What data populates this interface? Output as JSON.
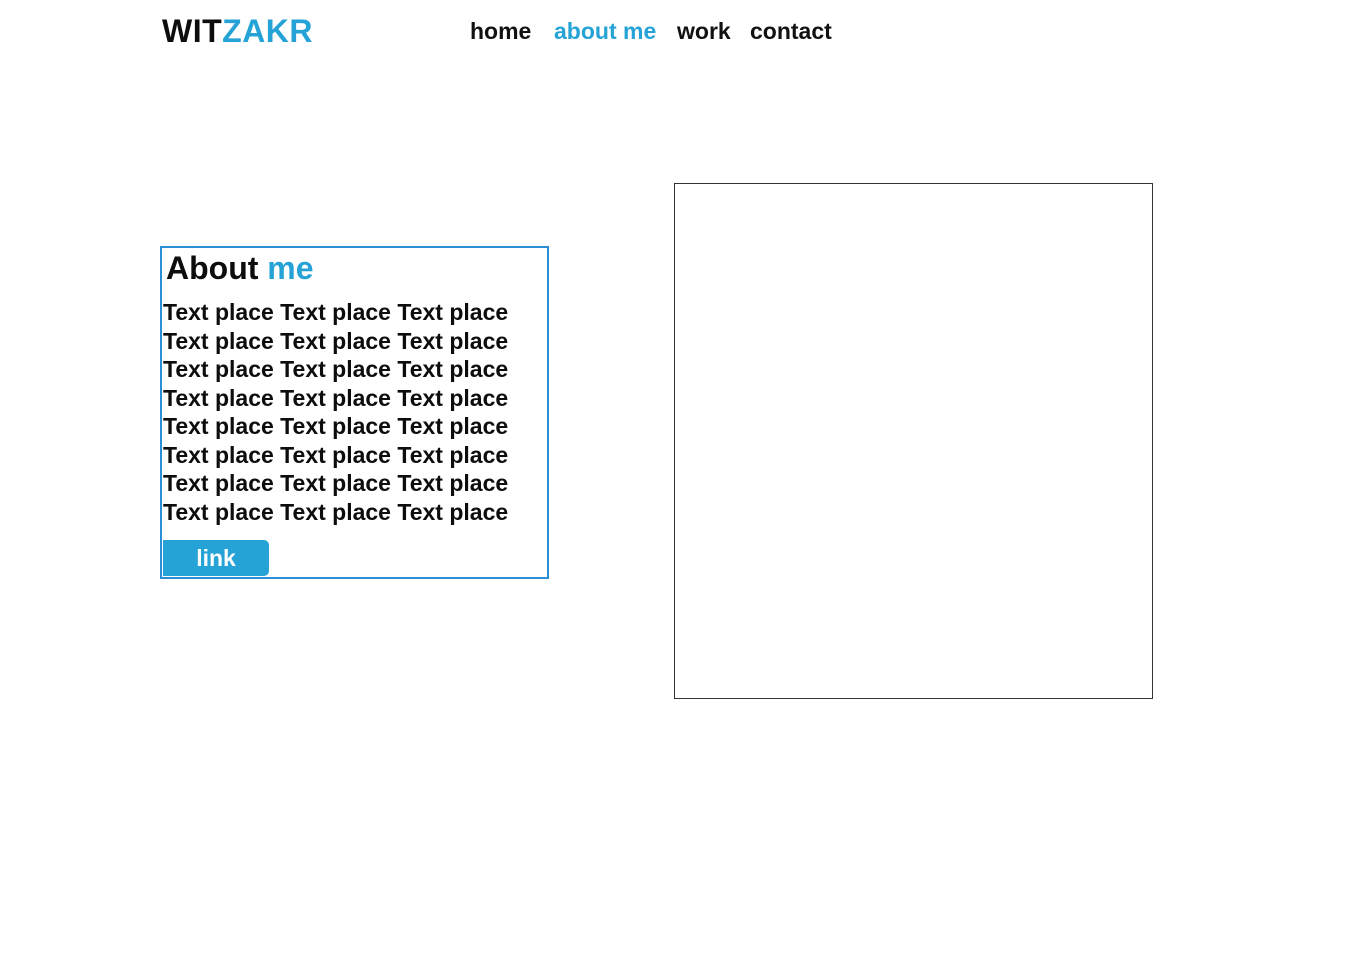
{
  "header": {
    "logo_part1": "WIT",
    "logo_part2": "ZAKR",
    "nav": [
      {
        "label": "home",
        "active": false
      },
      {
        "label": "about me",
        "active": true
      },
      {
        "label": "work",
        "active": false
      },
      {
        "label": "contact",
        "active": false
      }
    ]
  },
  "about": {
    "title_part1": "About",
    "title_part2": "me",
    "text_lines": [
      "Text place Text place Text place",
      "Text place Text place Text place",
      "Text place Text place Text place",
      "Text place Text place Text place",
      "Text place Text place Text place",
      "Text place Text place Text place",
      "Text place Text place Text place",
      "Text place Text place Text place"
    ],
    "button_label": "link"
  },
  "colors": {
    "accent": "#26a3d6",
    "box_border": "#2a8fd4",
    "text": "#0d0d0d"
  }
}
